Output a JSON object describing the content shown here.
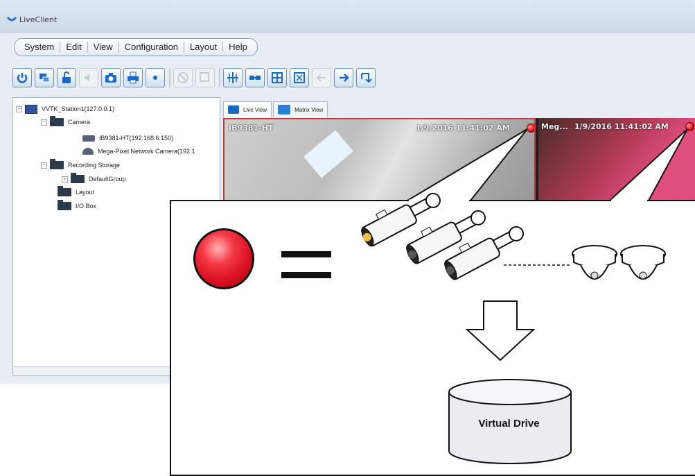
{
  "window": {
    "title": "LiveClient"
  },
  "menu": [
    "System",
    "Edit",
    "View",
    "Configuration",
    "Layout",
    "Help"
  ],
  "toolbar": [
    "power-icon",
    "monitor-icon",
    "unlock-icon",
    "audio-icon",
    "snapshot-icon",
    "print-icon",
    "record-icon",
    "stop-icon",
    "zoom-icon",
    "ptz-icon",
    "camera-link-icon",
    "grid-icon",
    "fullscreen-icon",
    "arrow-left-icon",
    "arrow-right-icon",
    "rotate-icon"
  ],
  "tree": {
    "station": "VVTK_Station1(127.0.0.1)",
    "camera": "Camera",
    "cam1": "IB9381-HT(192.168.6.150)",
    "cam2": "Mega-Pixel Network Camera(192.1",
    "recording": "Recording Storage",
    "group": "DefaultGroup",
    "layout": "Layout",
    "io": "I/O Box"
  },
  "tabs": {
    "live": "Live View",
    "matrix": "Matrix View"
  },
  "views": {
    "v1_name": "IB9381-HT",
    "v1_time": "1/9/2016 11:41:02 AM",
    "v2_name": "Meg...",
    "v2_time": "1/9/2016 11:41:02 AM"
  },
  "callout": {
    "drive_label": "Virtual Drive"
  },
  "colors": {
    "record_red": "#e10d18",
    "accent_blue": "#1769c4"
  }
}
